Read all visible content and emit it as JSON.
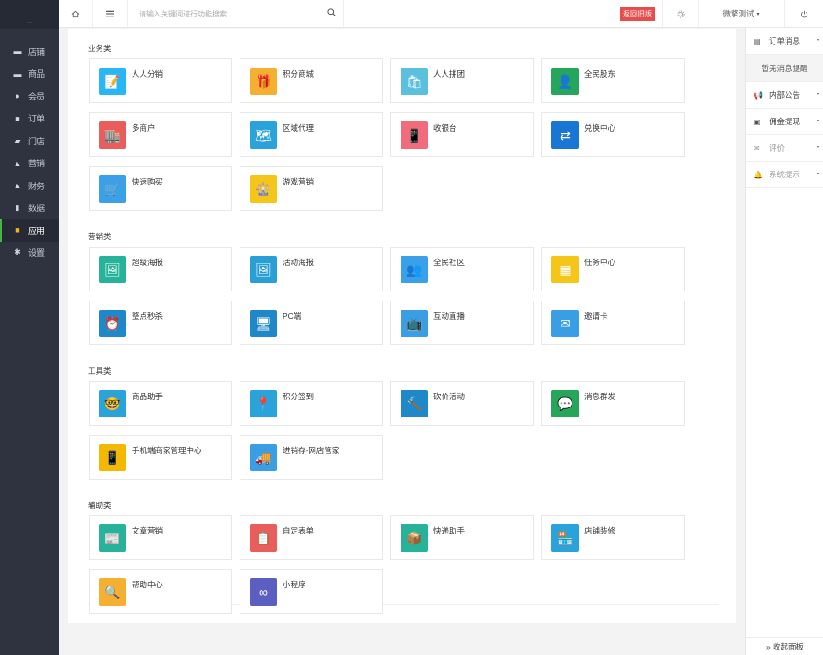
{
  "sidebar": {
    "logo_text": "···",
    "items": [
      {
        "label": "店铺",
        "icon": "store-icon",
        "glyph": "▬"
      },
      {
        "label": "商品",
        "icon": "goods-icon",
        "glyph": "▬"
      },
      {
        "label": "会员",
        "icon": "member-icon",
        "glyph": "●"
      },
      {
        "label": "订单",
        "icon": "order-icon",
        "glyph": "■"
      },
      {
        "label": "门店",
        "icon": "shop-icon",
        "glyph": "▰"
      },
      {
        "label": "营销",
        "icon": "marketing-icon",
        "glyph": "▲"
      },
      {
        "label": "财务",
        "icon": "finance-icon",
        "glyph": "▲"
      },
      {
        "label": "数据",
        "icon": "data-icon",
        "glyph": "▮"
      },
      {
        "label": "应用",
        "icon": "apps-icon",
        "glyph": "■"
      },
      {
        "label": "设置",
        "icon": "settings-icon",
        "glyph": "✱"
      }
    ],
    "active_index": 8
  },
  "topbar": {
    "search_placeholder": "请输入关键词进行功能搜索...",
    "return_old": "返回旧版",
    "user": "微擎测试",
    "user_caret": "▾"
  },
  "sections": [
    {
      "title": "业务类",
      "items": [
        {
          "label": "人人分销",
          "color": "#29b6f6",
          "glyph": "📝"
        },
        {
          "label": "积分商城",
          "color": "#f5b031",
          "glyph": "🎁"
        },
        {
          "label": "人人拼团",
          "color": "#5bc0de",
          "glyph": "🛍"
        },
        {
          "label": "全民股东",
          "color": "#26a65b",
          "glyph": "👤"
        },
        {
          "label": "多商户",
          "color": "#e95d5d",
          "glyph": "🏬"
        },
        {
          "label": "区域代理",
          "color": "#29a3d9",
          "glyph": "🗺"
        },
        {
          "label": "收银台",
          "color": "#f06b7b",
          "glyph": "📱"
        },
        {
          "label": "兑换中心",
          "color": "#1976d2",
          "glyph": "⇄"
        },
        {
          "label": "快速购买",
          "color": "#3aa0e8",
          "glyph": "🛒"
        },
        {
          "label": "游戏营销",
          "color": "#f5c518",
          "glyph": "🎡"
        }
      ]
    },
    {
      "title": "营销类",
      "items": [
        {
          "label": "超级海报",
          "color": "#26b39a",
          "glyph": "🖼"
        },
        {
          "label": "活动海报",
          "color": "#2a9fd6",
          "glyph": "🖼"
        },
        {
          "label": "全民社区",
          "color": "#3aa0e8",
          "glyph": "👥"
        },
        {
          "label": "任务中心",
          "color": "#f5c518",
          "glyph": "▦"
        },
        {
          "label": "整点秒杀",
          "color": "#1e88c9",
          "glyph": "⏰"
        },
        {
          "label": "PC端",
          "color": "#1e88c9",
          "glyph": "🖥"
        },
        {
          "label": "互动直播",
          "color": "#3a9ee4",
          "glyph": "📺"
        },
        {
          "label": "邀请卡",
          "color": "#3a9ee4",
          "glyph": "✉"
        }
      ]
    },
    {
      "title": "工具类",
      "items": [
        {
          "label": "商品助手",
          "color": "#29a3d9",
          "glyph": "🤓"
        },
        {
          "label": "积分签到",
          "color": "#29a3d9",
          "glyph": "📍"
        },
        {
          "label": "砍价活动",
          "color": "#1e88c9",
          "glyph": "🔨"
        },
        {
          "label": "消息群发",
          "color": "#26a65b",
          "glyph": "💬"
        },
        {
          "label": "手机端商家管理中心",
          "color": "#f5b800",
          "glyph": "📱"
        },
        {
          "label": "进销存-网店管家",
          "color": "#3a9ee4",
          "glyph": "🚚"
        }
      ]
    },
    {
      "title": "辅助类",
      "items": [
        {
          "label": "文章营销",
          "color": "#26b39a",
          "glyph": "📰"
        },
        {
          "label": "自定表单",
          "color": "#e95d5d",
          "glyph": "📋"
        },
        {
          "label": "快递助手",
          "color": "#26b39a",
          "glyph": "📦"
        },
        {
          "label": "店铺装修",
          "color": "#29a3d9",
          "glyph": "🏪"
        },
        {
          "label": "帮助中心",
          "color": "#f5b031",
          "glyph": "🔍"
        },
        {
          "label": "小程序",
          "color": "#5c5fc2",
          "glyph": "∞"
        }
      ]
    }
  ],
  "right_panel": {
    "order_msg": "订单消息",
    "empty_msg": "暂无消息提醒",
    "items": [
      {
        "label": "内部公告",
        "glyph": "📢",
        "caret": "▾"
      },
      {
        "label": "佣金提现",
        "glyph": "▣",
        "caret": "▾"
      },
      {
        "label": "评价",
        "glyph": "✉",
        "caret": "▾"
      },
      {
        "label": "系统提示",
        "glyph": "🔔",
        "caret": "▾"
      }
    ],
    "collapse": "» 收起面板"
  }
}
